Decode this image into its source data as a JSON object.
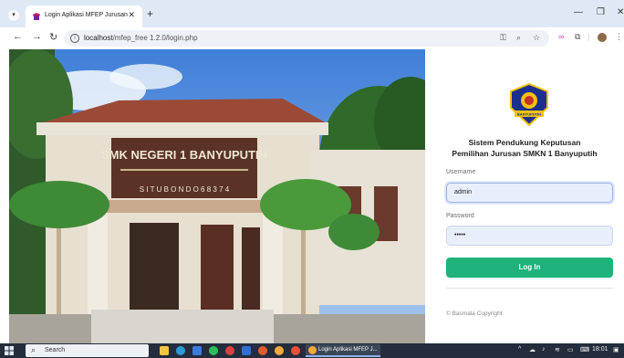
{
  "browser": {
    "tab_title": "Login Aplikasi MFEP Jurusan",
    "url_host": "localhost",
    "url_path": "/mfep_free 1.2.0/login.php"
  },
  "login": {
    "title_line1": "Sistem Pendukung Keputusan",
    "title_line2": "Pemilihan Jurusan SMKN 1 Banyuputih",
    "username_label": "Username",
    "username_value": "admin",
    "password_label": "Password",
    "password_value": "•••••",
    "submit_label": "Log In",
    "copyright": "© Basmala Copyright"
  },
  "photo": {
    "sign_line1": "SMK NEGERI 1 BANYUPUTIH",
    "sign_line3": "S I T U B O N D O  6 8 3 7 4"
  },
  "logo": {
    "banner_text": "BANYUPUTIH"
  },
  "taskbar": {
    "search_label": "Search",
    "active_app": "Login Aplikasi MFEP J...",
    "clock": "18:01"
  },
  "colors": {
    "accent_green": "#1fb27a",
    "input_bg": "#e9eefb",
    "tab_strip": "#dfe9f5"
  }
}
